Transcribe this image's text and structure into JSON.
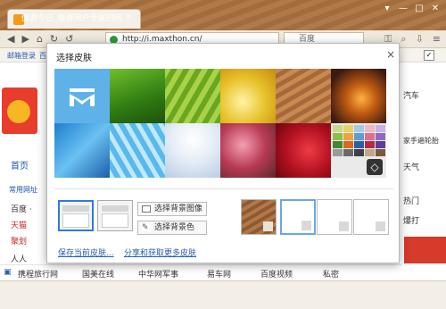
{
  "browser": {
    "tab_title": "傲游今日_傲游用户专属的网...",
    "tab_close": "×",
    "window_controls": [
      "▾",
      "—",
      "□",
      "✕"
    ],
    "address": "http://i.maxthon.cn/",
    "search_placeholder": "百度",
    "favorites": [
      "邮箱登录",
      "百"
    ]
  },
  "page": {
    "home_label": "首页",
    "common_sites_label": "常用网址",
    "side_items": [
      "百度 ·",
      "天猫",
      "聚划",
      "人人"
    ],
    "bottom_links": [
      "携程旅行网",
      "国美在线",
      "中华网军事",
      "易车网",
      "百度视频",
      "私密"
    ],
    "right_items": [
      "汽车",
      "家手遍轮胎",
      "天气",
      "热门",
      "爆打"
    ]
  },
  "dialog": {
    "title": "选择皮肤",
    "close": "×",
    "set_bg_image": "选择背景图像",
    "set_bg_color": "选择背景色",
    "save_current": "保存当前皮肤...",
    "share_more": "分享和获取更多皮肤",
    "theme_icon": "◇"
  },
  "colors": {
    "accent": "#2f7bd6",
    "link": "#2a5db0",
    "brand_red": "#e83d2c"
  }
}
